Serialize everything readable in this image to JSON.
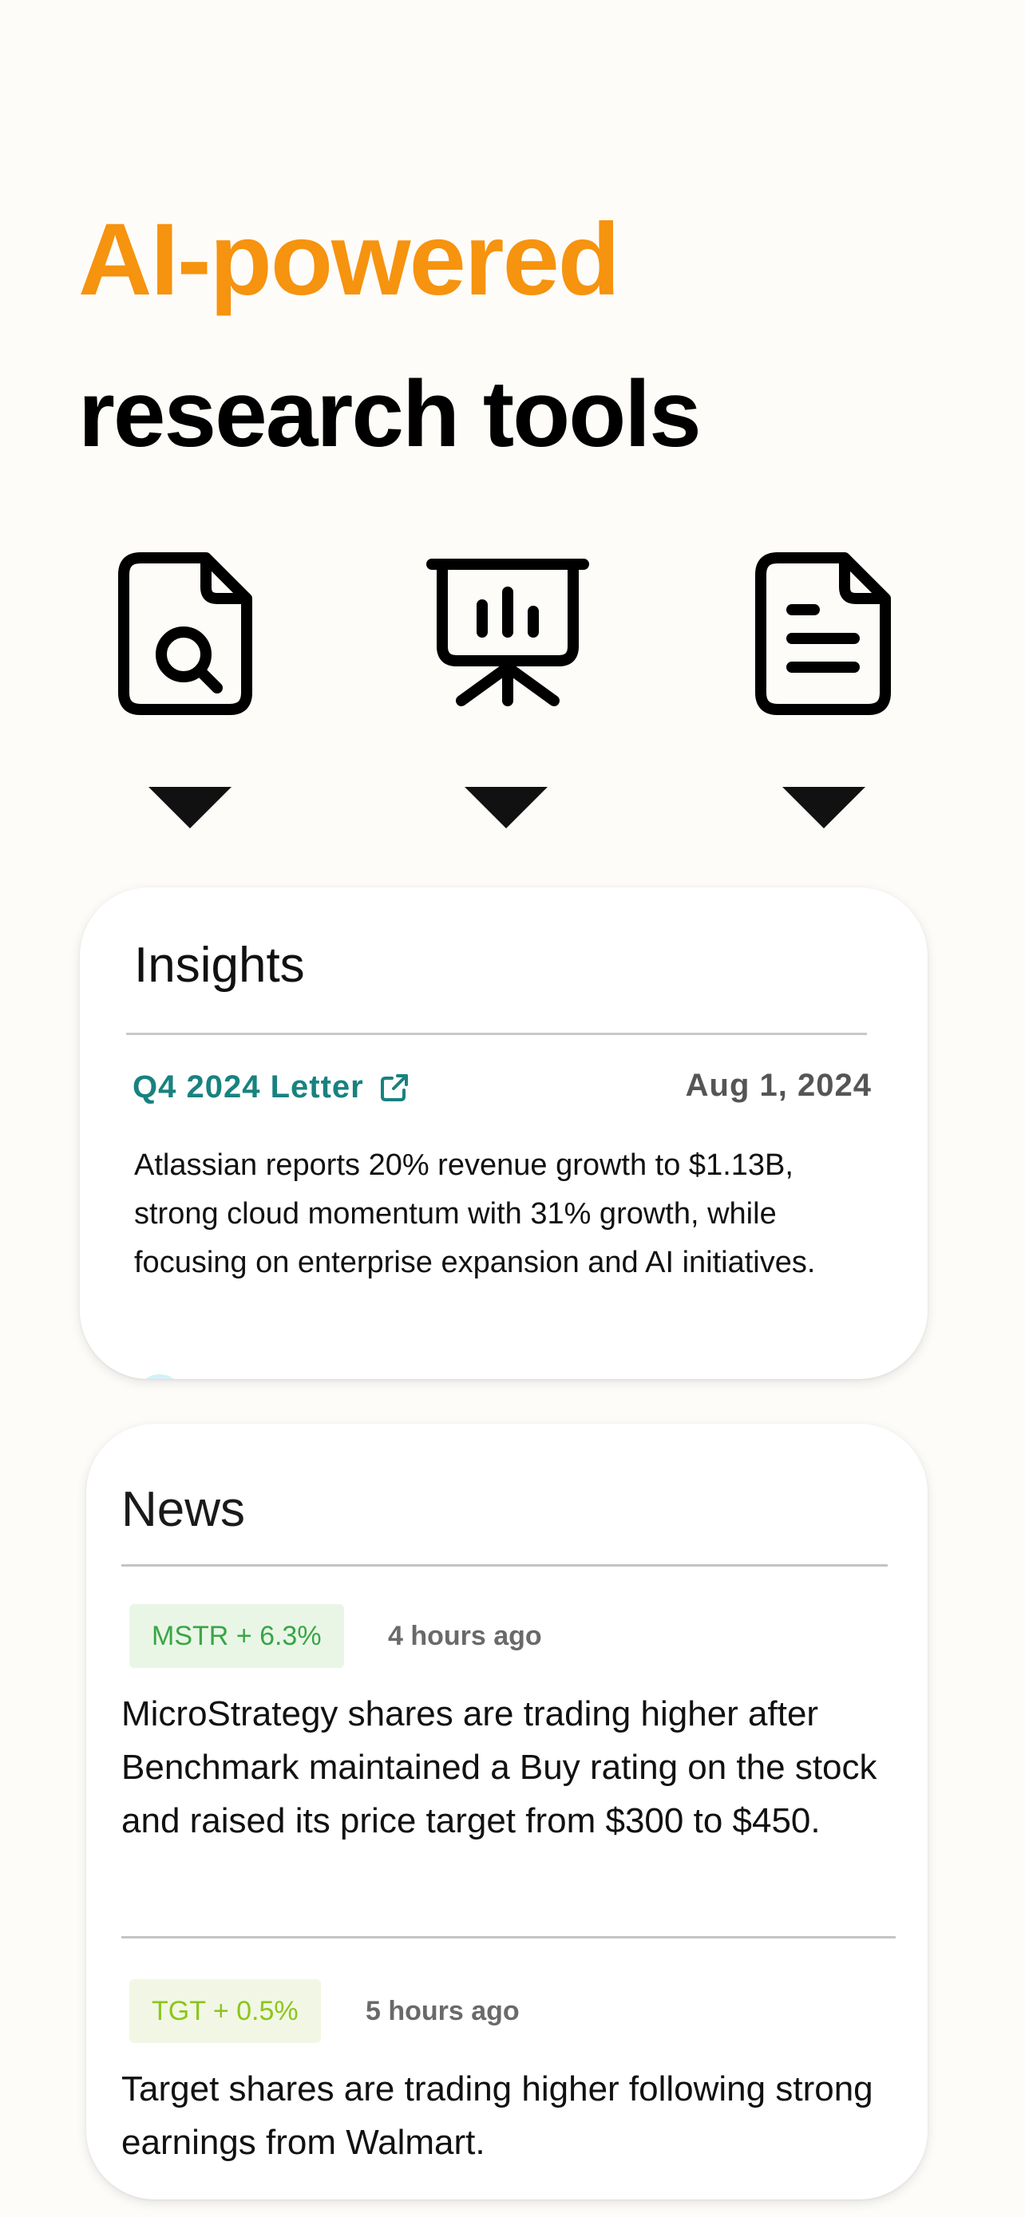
{
  "headline": {
    "line1": "AI-powered",
    "line2": "research tools"
  },
  "icons": [
    "document-search-icon",
    "presentation-chart-icon",
    "document-text-icon"
  ],
  "colors": {
    "accent": "#f6930f",
    "link": "#18827f",
    "positive_green": "#3aa547",
    "positive_lime": "#8cc51b"
  },
  "insights": {
    "title": "Insights",
    "link_label": "Q4 2024 Letter",
    "link_icon": "external-link-icon",
    "date": "Aug 1, 2024",
    "body": "Atlassian reports 20% revenue growth to $1.13B, strong cloud momentum with 31% growth, while focusing on enterprise expansion and AI initiatives."
  },
  "news": {
    "title": "News",
    "items": [
      {
        "ticker_badge": "MSTR + 6.3%",
        "time": "4 hours ago",
        "text": "MicroStrategy shares are trading higher after Benchmark maintained a Buy rating on the stock and raised its price target from $300 to $450."
      },
      {
        "ticker_badge": "TGT + 0.5%",
        "time": "5 hours ago",
        "text": "Target shares are trading higher following strong earnings from Walmart."
      }
    ]
  }
}
